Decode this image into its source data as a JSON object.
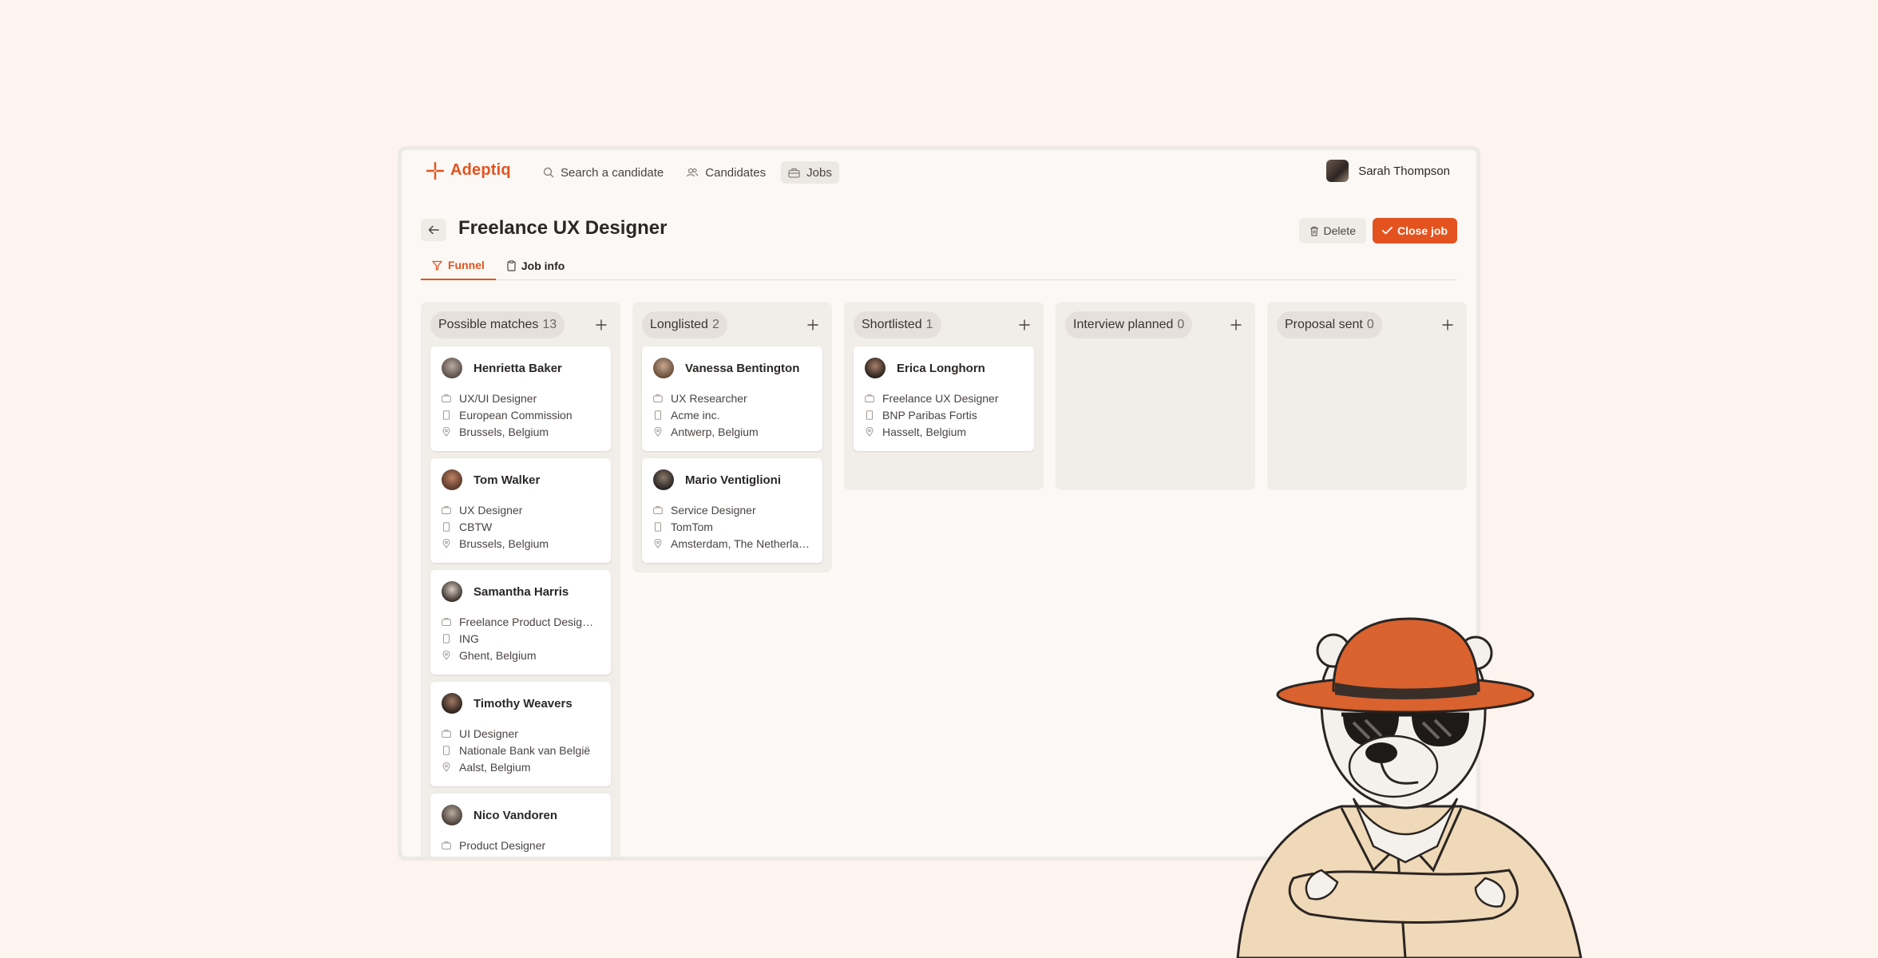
{
  "app": {
    "name": "Adeptiq",
    "brand_color": "#e4531f"
  },
  "nav": [
    {
      "label": "Search a candidate",
      "icon": "search-icon"
    },
    {
      "label": "Candidates",
      "icon": "users-icon"
    },
    {
      "label": "Jobs",
      "icon": "briefcase-icon",
      "active": true
    }
  ],
  "user": {
    "name": "Sarah Thompson"
  },
  "job": {
    "title": "Freelance UX Designer",
    "delete_label": "Delete",
    "close_label": "Close job"
  },
  "tabs": [
    {
      "label": "Funnel",
      "icon": "funnel-icon",
      "active": true
    },
    {
      "label": "Job info",
      "icon": "clipboard-icon"
    }
  ],
  "columns": [
    {
      "title": "Possible matches",
      "count": "13"
    },
    {
      "title": "Longlisted",
      "count": "2"
    },
    {
      "title": "Shortlisted",
      "count": "1"
    },
    {
      "title": "Interview planned",
      "count": "0"
    },
    {
      "title": "Proposal sent",
      "count": "0"
    }
  ],
  "cards": {
    "possible": [
      {
        "name": "Henrietta Baker",
        "role": "UX/UI Designer",
        "company": "European Commission",
        "location": "Brussels, Belgium"
      },
      {
        "name": "Tom Walker",
        "role": "UX Designer",
        "company": "CBTW",
        "location": "Brussels, Belgium"
      },
      {
        "name": "Samantha Harris",
        "role": "Freelance Product Desig…",
        "company": "ING",
        "location": "Ghent, Belgium"
      },
      {
        "name": "Timothy Weavers",
        "role": "UI Designer",
        "company": "Nationale Bank van België",
        "location": "Aalst, Belgium"
      },
      {
        "name": "Nico Vandoren",
        "role": "Product Designer"
      }
    ],
    "longlisted": [
      {
        "name": "Vanessa Bentington",
        "role": "UX Researcher",
        "company": "Acme inc.",
        "location": "Antwerp, Belgium"
      },
      {
        "name": "Mario Ventiglioni",
        "role": "Service Designer",
        "company": "TomTom",
        "location": "Amsterdam, The Netherlan…"
      }
    ],
    "shortlisted": [
      {
        "name": "Erica Longhorn",
        "role": "Freelance UX Designer",
        "company": "BNP Paribas Fortis",
        "location": "Hasselt, Belgium"
      }
    ]
  }
}
